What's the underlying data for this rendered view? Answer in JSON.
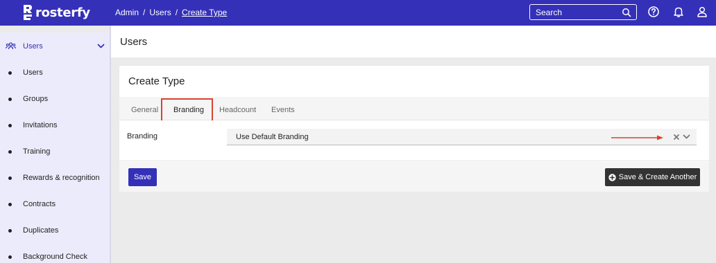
{
  "brand": {
    "name": "rosterfy",
    "accent": "#3430b8",
    "highlight": "#d8432f"
  },
  "breadcrumb": [
    {
      "label": "Admin",
      "link": false
    },
    {
      "label": "Users",
      "link": false
    },
    {
      "label": "Create Type",
      "link": true
    }
  ],
  "search": {
    "placeholder": "Search",
    "value": "",
    "icon": "search-icon"
  },
  "header_icons": [
    "help-icon",
    "bell-icon",
    "user-icon"
  ],
  "sidebar": {
    "section": {
      "label": "Users",
      "icon": "users-group-icon",
      "expanded": true
    },
    "items": [
      {
        "label": "Users"
      },
      {
        "label": "Groups"
      },
      {
        "label": "Invitations"
      },
      {
        "label": "Training"
      },
      {
        "label": "Rewards & recognition"
      },
      {
        "label": "Contracts"
      },
      {
        "label": "Duplicates"
      },
      {
        "label": "Background Check"
      }
    ]
  },
  "page": {
    "title": "Users"
  },
  "form": {
    "title": "Create Type",
    "tabs": [
      {
        "label": "General",
        "active": false
      },
      {
        "label": "Branding",
        "active": true
      },
      {
        "label": "Headcount",
        "active": false
      },
      {
        "label": "Events",
        "active": false
      }
    ],
    "field": {
      "label": "Branding",
      "value": "Use Default Branding"
    },
    "save_label": "Save",
    "save_another_label": "Save & Create Another"
  }
}
